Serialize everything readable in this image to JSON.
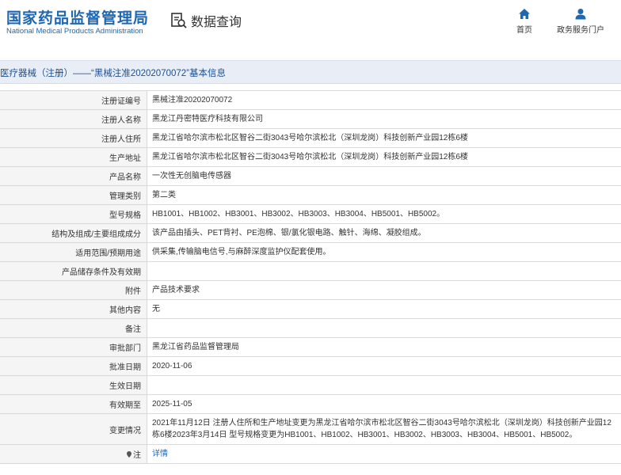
{
  "header": {
    "logo_cn": "国家药品监督管理局",
    "logo_en": "National Medical Products Administration",
    "query_label": "数据查询",
    "nav": [
      {
        "label": "首页",
        "icon": "home-icon"
      },
      {
        "label": "政务服务门户",
        "icon": "user-icon"
      }
    ]
  },
  "title": "医疗器械（注册）——“黑械注准20202070072”基本信息",
  "rows": [
    {
      "label": "注册证编号",
      "value": "黑械注准20202070072"
    },
    {
      "label": "注册人名称",
      "value": "黑龙江丹密特医疗科技有限公司"
    },
    {
      "label": "注册人住所",
      "value": "黑龙江省哈尔滨市松北区智谷二街3043号哈尔滨松北（深圳龙岗）科技创新产业园12栋6楼"
    },
    {
      "label": "生产地址",
      "value": "黑龙江省哈尔滨市松北区智谷二街3043号哈尔滨松北（深圳龙岗）科技创新产业园12栋6楼"
    },
    {
      "label": "产品名称",
      "value": "一次性无创脑电传感器"
    },
    {
      "label": "管理类别",
      "value": "第二类"
    },
    {
      "label": "型号规格",
      "value": "HB1001、HB1002、HB3001、HB3002、HB3003、HB3004、HB5001、HB5002。"
    },
    {
      "label": "结构及组成/主要组成成分",
      "value": "该产品由插头、PET背衬、PE泡棉、银/氯化银电路、触针、海绵、凝胶组成。"
    },
    {
      "label": "适用范围/预期用途",
      "value": "供采集,传输脑电信号,与麻醉深度监护仪配套使用。"
    },
    {
      "label": "产品储存条件及有效期",
      "value": ""
    },
    {
      "label": "附件",
      "value": "产品技术要求"
    },
    {
      "label": "其他内容",
      "value": "无"
    },
    {
      "label": "备注",
      "value": ""
    },
    {
      "label": "审批部门",
      "value": "黑龙江省药品监督管理局"
    },
    {
      "label": "批准日期",
      "value": "2020-11-06"
    },
    {
      "label": "生效日期",
      "value": ""
    },
    {
      "label": "有效期至",
      "value": "2025-11-05"
    },
    {
      "label": "变更情况",
      "value": "2021年11月12日 注册人住所和生产地址变更为黑龙江省哈尔滨市松北区智谷二街3043号哈尔滨松北（深圳龙岗）科技创新产业园12栋6楼2023年3月14日 型号规格变更为HB1001、HB1002、HB3001、HB3002、HB3003、HB3004、HB5001、HB5002。"
    }
  ],
  "note": {
    "label": "注",
    "link": "详情"
  }
}
